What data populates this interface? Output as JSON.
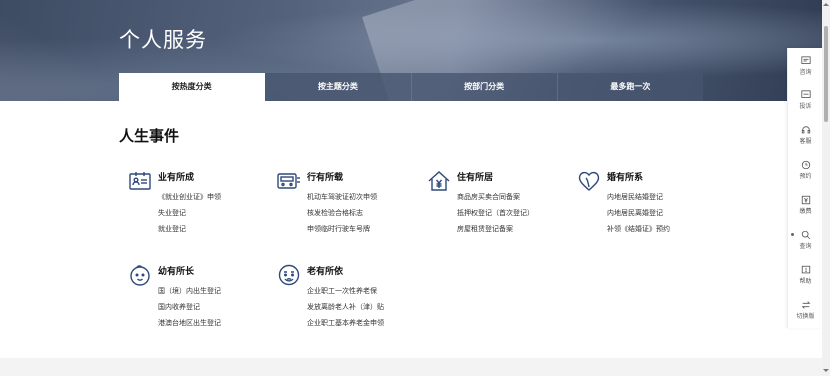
{
  "page_title": "个人服务",
  "tabs": [
    {
      "label": "按热度分类",
      "active": true
    },
    {
      "label": "按主题分类",
      "active": false
    },
    {
      "label": "按部门分类",
      "active": false
    },
    {
      "label": "最多跑一次",
      "active": false
    }
  ],
  "section_title": "人生事件",
  "categories": [
    {
      "name": "业有所成",
      "icon": "id-card-icon",
      "items": [
        "《就业创业证》申领",
        "失业登记",
        "就业登记"
      ]
    },
    {
      "name": "行有所载",
      "icon": "bus-icon",
      "items": [
        "机动车驾驶证初次申领",
        "核发检验合格标志",
        "申领临时行驶车号牌"
      ]
    },
    {
      "name": "住有所居",
      "icon": "house-yuan-icon",
      "items": [
        "商品房买卖合同备案",
        "抵押权登记（首次登记）",
        "房屋租赁登记备案"
      ]
    },
    {
      "name": "婚有所系",
      "icon": "heart-icon",
      "items": [
        "内地居民结婚登记",
        "内地居民离婚登记",
        "补领《结婚证》预约"
      ]
    },
    {
      "name": "幼有所长",
      "icon": "baby-face-icon",
      "items": [
        "国（境）内出生登记",
        "国内收养登记",
        "港澳台地区出生登记"
      ]
    },
    {
      "name": "老有所依",
      "icon": "elder-face-icon",
      "items": [
        "企业职工一次性养老保",
        "发放离龄老人补（津）贴",
        "企业职工基本养老金申领"
      ]
    }
  ],
  "sidebar": [
    {
      "label": "咨询",
      "icon": "chat-icon"
    },
    {
      "label": "投诉",
      "icon": "complaint-icon"
    },
    {
      "label": "客服",
      "icon": "headset-icon"
    },
    {
      "label": "预约",
      "icon": "clock-icon"
    },
    {
      "label": "缴费",
      "icon": "payment-icon"
    },
    {
      "label": "查询",
      "icon": "search-icon"
    },
    {
      "label": "帮助",
      "icon": "help-icon"
    },
    {
      "label": "切换版",
      "icon": "switch-icon"
    }
  ],
  "colors": {
    "accent": "#2f4a7a",
    "tab_bg": "#4a5a75",
    "text": "#222222"
  }
}
